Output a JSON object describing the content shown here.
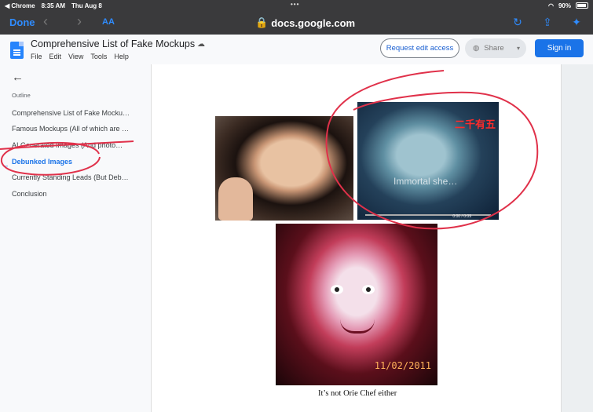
{
  "status_bar": {
    "back_app": "◀ Chrome",
    "time": "8:35 AM",
    "date": "Thu Aug 8",
    "dots": "•••",
    "battery": "90%"
  },
  "safari": {
    "done": "Done",
    "aa": "AA",
    "url": "docs.google.com"
  },
  "doc": {
    "title": "Comprehensive List of Fake Mockups",
    "menu": [
      "File",
      "Edit",
      "View",
      "Tools",
      "Help"
    ],
    "request_edit": "Request edit access",
    "share": "Share",
    "sign_in": "Sign in"
  },
  "outline": {
    "label": "Outline",
    "items": [
      "Comprehensive List of Fake Mocku…",
      "Famous Mockups (All of which are …",
      "AI Generated Images (And photo…",
      "Debunked Images",
      "Currently Standing Leads (But Deb…",
      "Conclusion"
    ],
    "active_index": 3
  },
  "content": {
    "video_overlay": "Immortal she…",
    "video_cjk": "二千有五",
    "video_time": "0:00 / 0:09",
    "photo_date_stamp": "11/02/2011",
    "caption": "It’s not Orie Chef either"
  },
  "colors": {
    "accent": "#1a73e8",
    "ink": "#e0314a"
  }
}
